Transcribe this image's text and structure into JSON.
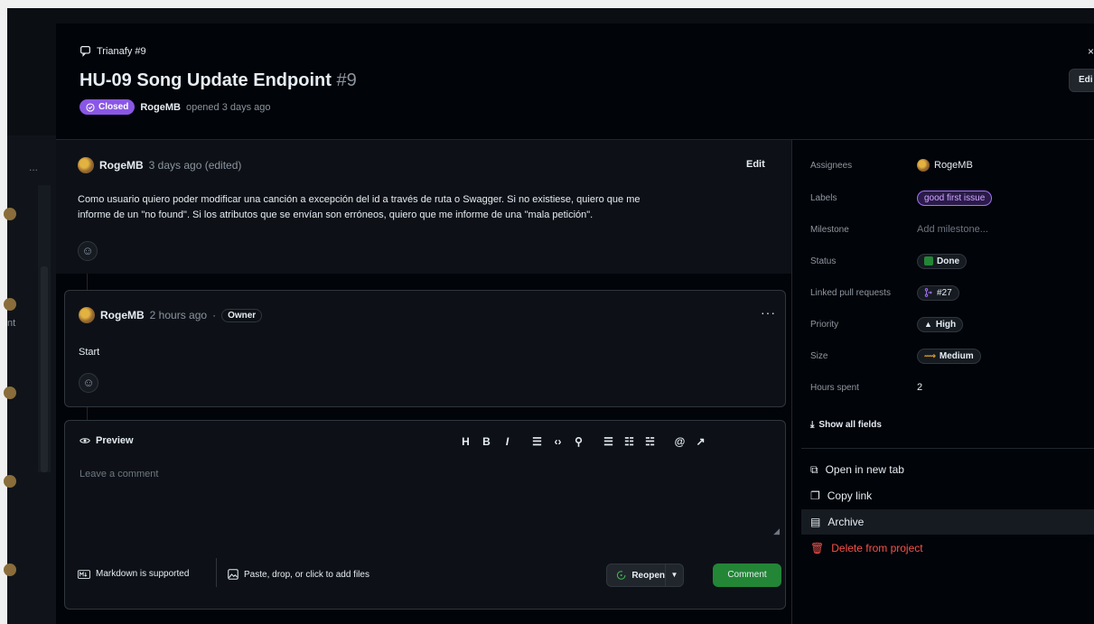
{
  "header": {
    "repo": "Trianafy #9",
    "title": "HU-09 Song Update Endpoint",
    "number": "#9",
    "status": "Closed",
    "author": "RogeMB",
    "opened_text": "opened 3 days ago",
    "edit_label": "Edi",
    "close_label": "×"
  },
  "comment1": {
    "author": "RogeMB",
    "time": "3 days ago (edited)",
    "edit_label": "Edit",
    "body_line1": "Como usuario quiero poder modificar una canción a excepción del id a través de ruta o Swagger. Si no existiese, quiero que me",
    "body_line2": "informe de un \"no found\". Si los atributos que se envían son erróneos, quiero que me informe de una \"mala petición\"."
  },
  "comment2": {
    "author": "RogeMB",
    "time": "2 hours ago",
    "separator": "·",
    "badge": "Owner",
    "body": "Start",
    "menu": "···"
  },
  "composer": {
    "tab": "Preview",
    "placeholder": "Leave a comment",
    "markdown_note": "Markdown is supported",
    "files_note": "Paste, drop, or click to add files",
    "reopen_label": "Reopen",
    "comment_label": "Comment",
    "toolbar": [
      "H",
      "B",
      "I",
      "list-ordered-icon",
      "code-icon",
      "link-icon",
      "bullet-list-icon",
      "numbered-list-icon",
      "task-list-icon",
      "mention-icon",
      "reference-icon"
    ]
  },
  "sidebar": {
    "fields": {
      "assignees_label": "Assignees",
      "assignees_value": "RogeMB",
      "labels_label": "Labels",
      "labels_value": "good first issue",
      "milestone_label": "Milestone",
      "milestone_value": "Add milestone...",
      "status_label": "Status",
      "status_value": "Done",
      "linked_label": "Linked pull requests",
      "linked_value": "#27",
      "priority_label": "Priority",
      "priority_value": "High",
      "size_label": "Size",
      "size_value": "Medium",
      "hours_label": "Hours spent",
      "hours_value": "2"
    },
    "show_all": "Show all fields",
    "actions": {
      "open_new_tab": "Open in new tab",
      "copy_link": "Copy link",
      "archive": "Archive",
      "delete": "Delete from project"
    }
  },
  "background": {
    "dots": "...",
    "snippet": "nt"
  },
  "colors": {
    "closed": "#8957e5",
    "done": "#238636",
    "danger": "#f85149",
    "label_border": "#a371f7"
  }
}
